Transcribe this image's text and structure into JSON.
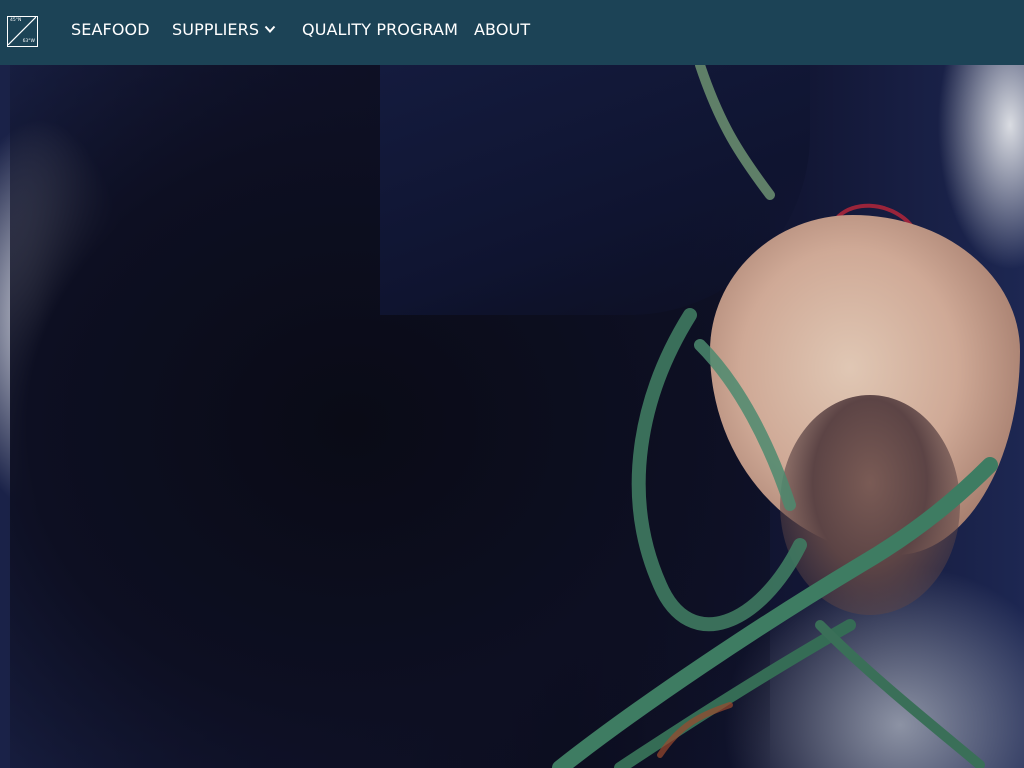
{
  "logo": {
    "top_text": "45°N",
    "bottom_text": "63°W",
    "icon": "diagonal-square-logo"
  },
  "nav": {
    "items": [
      {
        "label": "SEAFOOD"
      },
      {
        "label": "SUPPLIERS",
        "has_dropdown": true,
        "icon": "chevron-down-icon"
      },
      {
        "label": "QUALITY PROGRAM"
      },
      {
        "label": "ABOUT"
      }
    ]
  },
  "colors": {
    "navbar": "#1c4356",
    "nav_text": "#ffffff",
    "hero_dark": "#0b0c1c",
    "sweater_navy": "#1a2248",
    "rope_green": "#3f7a60"
  },
  "hero": {
    "image": "photo of a person in a navy sweater handling green fishing rope"
  }
}
